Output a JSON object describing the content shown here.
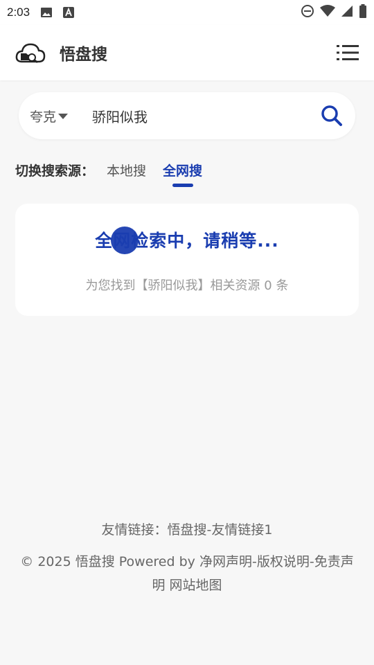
{
  "status": {
    "time": "2:03"
  },
  "app": {
    "title": "悟盘搜"
  },
  "search": {
    "source": "夸克",
    "query": "骄阳似我"
  },
  "switch": {
    "label": "切换搜索源：",
    "tabs": [
      {
        "label": "本地搜",
        "active": false
      },
      {
        "label": "全网搜",
        "active": true
      }
    ]
  },
  "result": {
    "loading": "全网检索中，请稍等...",
    "info": "为您找到【骄阳似我】相关资源 0 条"
  },
  "footer": {
    "friend_label": "友情链接：",
    "friend_links": [
      "悟盘搜",
      "友情链接1"
    ],
    "copyright": "© 2025 悟盘搜 Powered by",
    "links": [
      "净网声明",
      "版权说明",
      "免责声明",
      "网站地图"
    ]
  },
  "colors": {
    "accent": "#1a3db0",
    "background": "#f7f7f7"
  }
}
